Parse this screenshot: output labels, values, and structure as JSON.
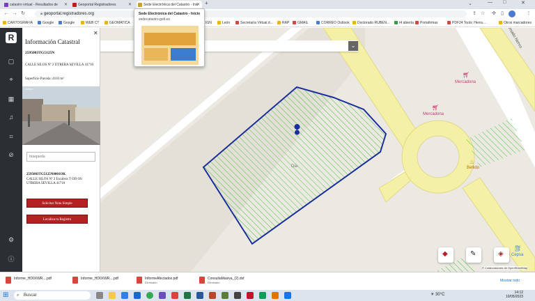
{
  "browser": {
    "tabs": [
      {
        "label": "catastro virtual - Resultados de",
        "color": "#7b3fc4"
      },
      {
        "label": "Geoportal Registradores",
        "color": "#b22222"
      },
      {
        "label": "Sede Electrónica del Catastro - Inic",
        "color": "#c9a227"
      }
    ],
    "url": "geoportal.registradores.org",
    "bookmarks": [
      "CARTOGRAFIA",
      "Google",
      "Google",
      "WEB CT",
      "GEOMATICA",
      "IGN",
      "León",
      "Secretaría Virtual d...",
      "RAP",
      "GMAIL",
      "CORREO Outlook",
      "Doctorado RUBEN...",
      "t4 abierta",
      "Portafirmas",
      "PDF24 Tools: Herra...",
      "Otros marcadores"
    ],
    "tooltip": {
      "title": "Sede Electrónica del Catastro - Inicio",
      "domain": "sedecatastro.gob.es"
    }
  },
  "panel": {
    "title": "Información Catastral",
    "refcat": "2595003TG5125N",
    "address": "CALLE SILOS Nº 2 UTRERA SEVILLA 41710",
    "surface": "Superficie Parcela: 4103 m²",
    "photo_label": "Catastro",
    "search_placeholder": "busqueda",
    "result_ref": "2595003TG5125N0001OK",
    "result_address": "CALLE SILOS Nº 2 Escalera T OD OS UTRERA SEVILLA 41710",
    "btn_nota": "Solicitar Nota Simple",
    "btn_localiza": "Localiza tu Registro"
  },
  "map": {
    "labels": {
      "mercadona1": "Mercadona",
      "mercadona2": "Mercadona",
      "dia": "Dia",
      "bellido": "Bellido",
      "nervo": "Amado Nervo",
      "cepsa": "Cepsa",
      "attribution": "© Colaboradores de OpenStreetMap"
    },
    "colors": {
      "parcel_stroke": "#1a2f9c",
      "parcel_hatch": "#44c23a",
      "road": "#f4f0a6",
      "poi": "#d6286f"
    }
  },
  "downloads": [
    {
      "name": "Informe_HD0XWR....pdf",
      "sub": ""
    },
    {
      "name": "Informe_HD0XWR....pdf",
      "sub": ""
    },
    {
      "name": "InformeAfectados.pdf",
      "sub": "Eliminado"
    },
    {
      "name": "ConsultaMasiva_(2).dxf",
      "sub": "Eliminado"
    },
    {
      "show_all": "Mostrar todo"
    }
  ],
  "taskbar": {
    "search": "Buscar",
    "weather": "30°C",
    "time": "14:12",
    "date": "10/05/2023"
  }
}
